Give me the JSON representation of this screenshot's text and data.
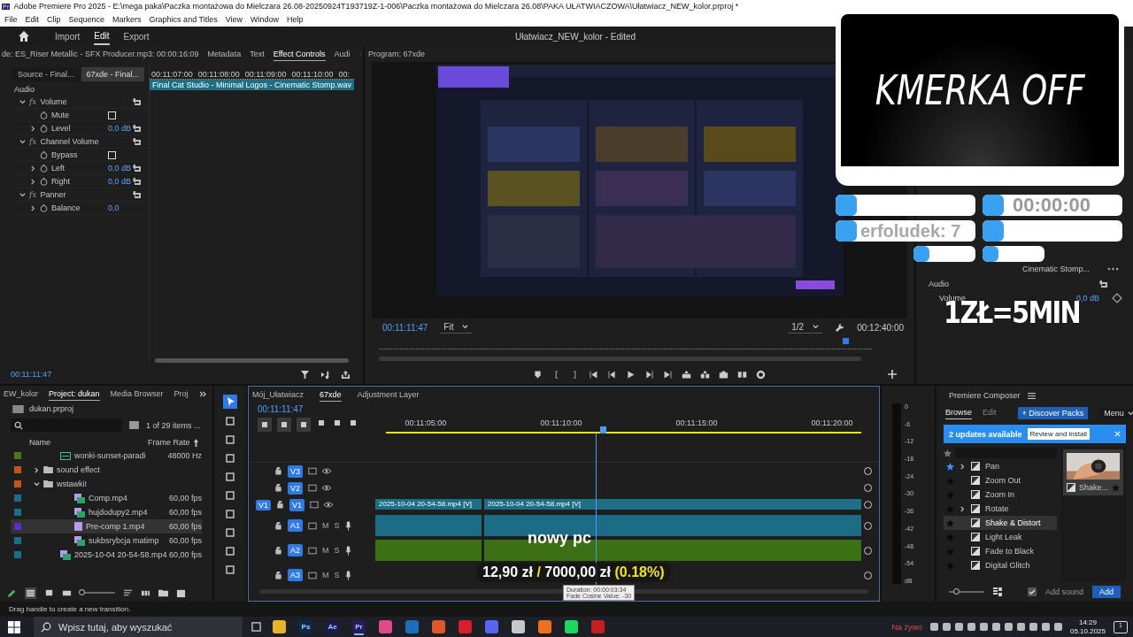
{
  "window": {
    "title": "Adobe Premiere Pro 2025 - E:\\mega paka\\Paczka montażowa do Mielczara 26.08-20250924T193719Z-1-006\\Paczka montażowa do Mielczara 26.08\\PAKA UŁATWIACZOWA\\Ułatwiacz_NEW_kolor.prproj *",
    "app_badge": "Pr"
  },
  "menu": [
    "File",
    "Edit",
    "Clip",
    "Sequence",
    "Markers",
    "Graphics and Titles",
    "View",
    "Window",
    "Help"
  ],
  "header": {
    "tabs": [
      {
        "label": "Import",
        "selected": false
      },
      {
        "label": "Edit",
        "selected": true
      },
      {
        "label": "Export",
        "selected": false
      }
    ],
    "project_title": "Ułatwiacz_NEW_kolor - Edited"
  },
  "effect_controls": {
    "tabs": [
      {
        "label": "de: ES_Riser Metallic - SFX Producer.mp3: 00:00:16:09",
        "selected": false
      },
      {
        "label": "Metadata",
        "selected": false
      },
      {
        "label": "Text",
        "selected": false
      },
      {
        "label": "Effect Controls",
        "selected": true
      },
      {
        "label": "Audi",
        "selected": false
      }
    ],
    "sources": [
      {
        "label": "Source - Final...",
        "selected": false
      },
      {
        "label": "67xde - Final...",
        "selected": true
      }
    ],
    "section": "Audio",
    "ruler": [
      "00:11:07:00",
      "00:11:08:00",
      "00:11:09:00",
      "00:11:10:00",
      "00:"
    ],
    "clip": "Final Cat Studio - Minimal Logos - Cinematic Stomp.wav",
    "effects": [
      {
        "badge": "fx",
        "label": "Volume",
        "expanded": true,
        "children": [
          {
            "label": "Mute",
            "kind": "checkbox",
            "checked": false
          },
          {
            "label": "Level",
            "kind": "value",
            "value": "0,0 dB",
            "expanded": false
          }
        ]
      },
      {
        "badge": "fx",
        "label": "Channel Volume",
        "expanded": true,
        "children": [
          {
            "label": "Bypass",
            "kind": "checkbox",
            "checked": false
          },
          {
            "label": "Left",
            "kind": "value",
            "value": "0,0 dB",
            "expanded": false
          },
          {
            "label": "Right",
            "kind": "value",
            "value": "0,0 dB",
            "expanded": false
          }
        ]
      },
      {
        "badge": "fx",
        "label": "Panner",
        "expanded": true,
        "children": [
          {
            "label": "Balance",
            "kind": "value",
            "value": "0,0",
            "expanded": false
          }
        ]
      }
    ],
    "timecode": "00:11:11:47"
  },
  "program": {
    "title": "Program: 67xde",
    "timecode": "00:11:11:47",
    "zoom": "Fit",
    "resolution": "1/2",
    "duration": "00:12:40:00"
  },
  "right_panel": {
    "clip": "Cinematic Stomp...",
    "section": "Audio",
    "param": "Volume",
    "value": "0,0 dB"
  },
  "overlay": {
    "camera_text": "KMERKA OFF",
    "timer": "00:00:00",
    "ticker": "erfoludek: 7",
    "rate": "1ZŁ=5MIN"
  },
  "project": {
    "tabs": [
      {
        "label": "EW_kolor",
        "selected": false
      },
      {
        "label": "Project: dukan",
        "selected": true
      },
      {
        "label": "Media Browser",
        "selected": false
      },
      {
        "label": "Proj",
        "selected": false
      }
    ],
    "zoom_slider": {
      "level": 0.05
    },
    "file": "dukan.prproj",
    "count": "1 of 29 items ...",
    "columns": [
      "Name",
      "Frame Rate"
    ],
    "rows": [
      {
        "name": "wonki-sunset-paradi",
        "kind": "audio",
        "rate": "48000 Hz",
        "color": "#4a7a1c",
        "selected": false
      },
      {
        "name": "sound effect",
        "kind": "folder",
        "color": "#c0561c",
        "expanded": false,
        "selected": false
      },
      {
        "name": "wstawki!",
        "kind": "folder",
        "color": "#c0561c",
        "expanded": true,
        "selected": false,
        "children": [
          {
            "name": "Comp.mp4",
            "kind": "video",
            "rate": "60,00 fps",
            "color": "#1a6e8a",
            "selected": false
          },
          {
            "name": "hujdodupy2.mp4",
            "kind": "video",
            "rate": "60,00 fps",
            "color": "#1a6e8a",
            "selected": false
          },
          {
            "name": "Pre-comp 1.mp4",
            "kind": "comp",
            "rate": "60,00 fps",
            "color": "#5a2fc8",
            "selected": true
          },
          {
            "name": "sukbsrybcja matimp",
            "kind": "video",
            "rate": "60,00 fps",
            "color": "#1a6e8a",
            "selected": false
          }
        ]
      },
      {
        "name": "2025-10-04 20-54-58.mp4",
        "kind": "video",
        "rate": "60,00 fps",
        "color": "#1a6e8a",
        "selected": false
      }
    ]
  },
  "timeline": {
    "tabs": [
      {
        "label": "Mój_Ułatwiacz",
        "selected": false
      },
      {
        "label": "67xde",
        "selected": true
      },
      {
        "label": "Adjustment Layer",
        "selected": false
      }
    ],
    "timecode": "00:11:11:47",
    "ruler": [
      "00:11:05:00",
      "00:11:10:00",
      "00:11:15:00",
      "00:11:20:00"
    ],
    "tracks": [
      {
        "label": "V3",
        "kind": "video"
      },
      {
        "label": "V2",
        "kind": "video"
      },
      {
        "label": "V1",
        "kind": "video",
        "patch": "V1",
        "clips": [
          "2025-10-04 20-54-58.mp4 [V]",
          "2025-10-04 20-54-58.mp4 [V]"
        ]
      },
      {
        "label": "A1",
        "kind": "audio",
        "buttons": [
          "M",
          "S"
        ],
        "color": "#1c6c85"
      },
      {
        "label": "A2",
        "kind": "audio",
        "buttons": [
          "M",
          "S"
        ],
        "color": "#3d6f14"
      },
      {
        "label": "A3",
        "kind": "audio",
        "buttons": [
          "M",
          "S"
        ]
      }
    ],
    "caption": "nowy pc",
    "price": [
      {
        "text": "12,90 zł",
        "accent": false
      },
      {
        "text": "/",
        "accent": true
      },
      {
        "text": "7000,00 zł",
        "accent": false
      },
      {
        "text": "(0.18%)",
        "accent": true
      }
    ],
    "tooltip": [
      "Duration: 00:00:03:34",
      "Fade Cosine Value: -30"
    ]
  },
  "meters": {
    "scale": [
      "0",
      "-6",
      "-12",
      "-18",
      "-24",
      "-30",
      "-36",
      "-42",
      "-48",
      "-54",
      "dB"
    ]
  },
  "composer": {
    "title": "Premiere Composer",
    "tabs": [
      {
        "label": "Browse",
        "selected": true
      },
      {
        "label": "Edit",
        "selected": false
      }
    ],
    "discover": "+ Discover Packs",
    "menu": "Menu",
    "banner": "2 updates available",
    "banner_action": "Review and install",
    "items": [
      {
        "label": "Pan",
        "starred": true,
        "expanded": false,
        "selected": false
      },
      {
        "label": "Zoom Out",
        "starred": false,
        "selected": false
      },
      {
        "label": "Zoom In",
        "starred": false,
        "selected": false
      },
      {
        "label": "Rotate",
        "starred": false,
        "expanded": false,
        "selected": false
      },
      {
        "label": "Shake & Distort",
        "starred": false,
        "selected": true
      },
      {
        "label": "Light Leak",
        "starred": false,
        "selected": false
      },
      {
        "label": "Fade to Black",
        "starred": false,
        "selected": false
      },
      {
        "label": "Digital Glitch",
        "starred": false,
        "selected": false
      }
    ],
    "size_slider": {
      "level": 0.2
    },
    "preview": "Shake...",
    "add_sound": {
      "label": "Add sound",
      "checked": true
    },
    "add": "Add"
  },
  "status_bar": "Drag handle to create a new transition.",
  "taskbar": {
    "search": "Wpisz tutaj, aby wyszukać",
    "apps": [
      {
        "color": "#e8b32a",
        "selected": false
      },
      {
        "label": "Ps",
        "color": "#0b2a4a",
        "selected": false
      },
      {
        "label": "Ae",
        "color": "#1c1a4a",
        "selected": false
      },
      {
        "label": "Pr",
        "color": "#2a1a5a",
        "selected": true
      },
      {
        "color": "#e04a8a",
        "selected": false
      },
      {
        "color": "#1b6fb8",
        "selected": false
      },
      {
        "color": "#e0552a",
        "selected": false
      },
      {
        "color": "#d81e2a",
        "selected": false
      },
      {
        "color": "#5865f2",
        "selected": false
      },
      {
        "color": "#c8c8c8",
        "selected": false
      },
      {
        "color": "#f07020",
        "selected": false
      },
      {
        "color": "#1ed760",
        "selected": false
      },
      {
        "color": "#c41e1e",
        "selected": false
      }
    ],
    "live": "Na żywo",
    "time": "14:29",
    "date": "05.10.2025",
    "notifications": "1"
  }
}
